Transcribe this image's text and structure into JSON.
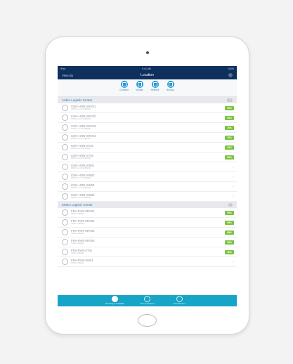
{
  "statusbar": {
    "left": "iPad",
    "time": "9:41 AM",
    "right": "100%"
  },
  "navbar": {
    "left_label": "View By",
    "title": "Location"
  },
  "toolbar": {
    "items": [
      {
        "label": "Compute",
        "icon": "compute-icon"
      },
      {
        "label": "Virtualz",
        "icon": "virtual-icon"
      },
      {
        "label": "Network",
        "icon": "network-icon"
      },
      {
        "label": "Backup",
        "icon": "backup-icon"
      }
    ]
  },
  "sections": [
    {
      "title": "Arden Logistic Center",
      "badge": "10",
      "rows": [
        {
          "name": "CHN-HON-SRV01",
          "sub": "ONRLS an D3 (#BAM)",
          "status": "99%"
        },
        {
          "name": "CHN-HON-SRV02",
          "sub": "ONRLS an D3 (#BAM)",
          "status": "99%"
        },
        {
          "name": "CHN-HON-SRV03",
          "sub": "ONRLS an D3 (#BAM)",
          "status": "76%"
        },
        {
          "name": "CHN-HON-SRV04",
          "sub": "ONRLS an D3 (#BAM)",
          "status": "75%"
        },
        {
          "name": "CHN-HON-ST01",
          "sub": "ONRLS an D3 (#BAM)",
          "status": "43%"
        },
        {
          "name": "CHN-HON-ST02",
          "sub": "ONRLS an D3 (#BAM)",
          "status": "59%"
        },
        {
          "name": "CHN-HON-SW01",
          "sub": "ONRLS an D3 (#BAM)",
          "status": ""
        },
        {
          "name": "CHN-HON-SW02",
          "sub": "ONRLS an D3 (#BAM)",
          "status": ""
        },
        {
          "name": "CHN-HON-SW03",
          "sub": "ONRLS an D3 (#BAM)",
          "status": ""
        },
        {
          "name": "CHN-HON-SW04",
          "sub": "ONRLS an D3 (#BAM)",
          "status": ""
        }
      ]
    },
    {
      "title": "EMEA Logistic Center",
      "badge": "6",
      "rows": [
        {
          "name": "FRA-PAR-SRV01",
          "sub": "ONRLS #BAM",
          "status": "99%"
        },
        {
          "name": "FRA-PAR-SRV02",
          "sub": "ONRLS #BAM",
          "status": "99%"
        },
        {
          "name": "FRA-PAR-SRV03",
          "sub": "ONRLS #BAM",
          "status": "99%"
        },
        {
          "name": "FRA-PAR-SRV04",
          "sub": "ONRLS #BAM",
          "status": "99%"
        },
        {
          "name": "FRA-PAR-ST01",
          "sub": "ONRLS #BAM",
          "status": "40%"
        },
        {
          "name": "FRA-PAR-SW01",
          "sub": "ONRLS #BAM",
          "status": ""
        }
      ]
    }
  ],
  "tabbar": {
    "items": [
      {
        "label": "Monitoring & Availability",
        "active": true
      },
      {
        "label": "Server Operations",
        "active": false
      },
      {
        "label": "Cloud Monitors",
        "active": false
      }
    ]
  },
  "colors": {
    "nav": "#0f2f5c",
    "accent": "#2196d3",
    "status_ok": "#7cc243",
    "tabbar": "#16a4c7"
  }
}
